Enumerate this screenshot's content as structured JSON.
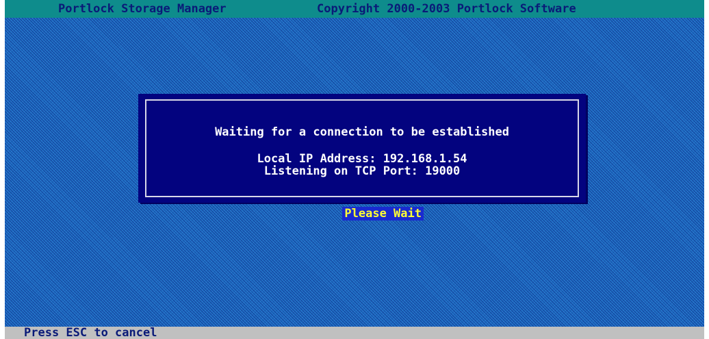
{
  "header": {
    "app_title": "Portlock Storage Manager",
    "copyright": "Copyright 2000-2003 Portlock Software"
  },
  "dialog": {
    "heading": "Waiting for a connection to be established",
    "ip_line": "Local IP Address: 192.168.1.54",
    "port_line": "Listening on TCP Port: 19000",
    "wait_text": "Please Wait"
  },
  "status_bar": {
    "hint": "Press ESC to cancel"
  },
  "colors": {
    "title_bar": "#0e8c8c",
    "desktop": "#1f6ec4",
    "dialog_bg": "#03037f",
    "wait_highlight": "#1a2ad0",
    "wait_text": "#ffff33",
    "status_bar": "#c0c0c0"
  }
}
